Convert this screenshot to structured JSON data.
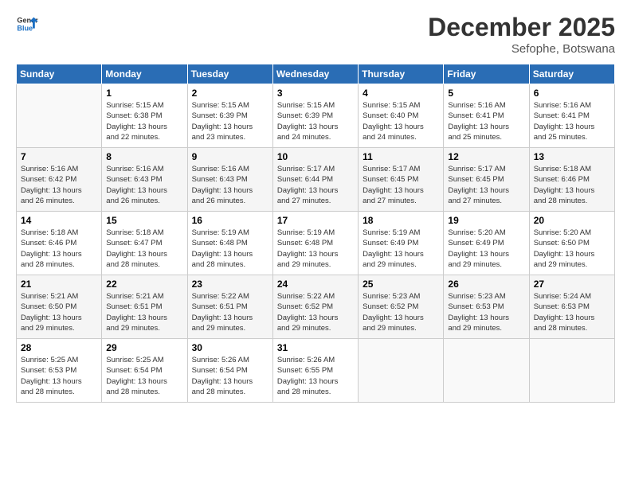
{
  "logo": {
    "line1": "General",
    "line2": "Blue"
  },
  "title": "December 2025",
  "subtitle": "Sefophe, Botswana",
  "days_header": [
    "Sunday",
    "Monday",
    "Tuesday",
    "Wednesday",
    "Thursday",
    "Friday",
    "Saturday"
  ],
  "weeks": [
    [
      {
        "day": "",
        "info": ""
      },
      {
        "day": "1",
        "info": "Sunrise: 5:15 AM\nSunset: 6:38 PM\nDaylight: 13 hours\nand 22 minutes."
      },
      {
        "day": "2",
        "info": "Sunrise: 5:15 AM\nSunset: 6:39 PM\nDaylight: 13 hours\nand 23 minutes."
      },
      {
        "day": "3",
        "info": "Sunrise: 5:15 AM\nSunset: 6:39 PM\nDaylight: 13 hours\nand 24 minutes."
      },
      {
        "day": "4",
        "info": "Sunrise: 5:15 AM\nSunset: 6:40 PM\nDaylight: 13 hours\nand 24 minutes."
      },
      {
        "day": "5",
        "info": "Sunrise: 5:16 AM\nSunset: 6:41 PM\nDaylight: 13 hours\nand 25 minutes."
      },
      {
        "day": "6",
        "info": "Sunrise: 5:16 AM\nSunset: 6:41 PM\nDaylight: 13 hours\nand 25 minutes."
      }
    ],
    [
      {
        "day": "7",
        "info": "Sunrise: 5:16 AM\nSunset: 6:42 PM\nDaylight: 13 hours\nand 26 minutes."
      },
      {
        "day": "8",
        "info": "Sunrise: 5:16 AM\nSunset: 6:43 PM\nDaylight: 13 hours\nand 26 minutes."
      },
      {
        "day": "9",
        "info": "Sunrise: 5:16 AM\nSunset: 6:43 PM\nDaylight: 13 hours\nand 26 minutes."
      },
      {
        "day": "10",
        "info": "Sunrise: 5:17 AM\nSunset: 6:44 PM\nDaylight: 13 hours\nand 27 minutes."
      },
      {
        "day": "11",
        "info": "Sunrise: 5:17 AM\nSunset: 6:45 PM\nDaylight: 13 hours\nand 27 minutes."
      },
      {
        "day": "12",
        "info": "Sunrise: 5:17 AM\nSunset: 6:45 PM\nDaylight: 13 hours\nand 27 minutes."
      },
      {
        "day": "13",
        "info": "Sunrise: 5:18 AM\nSunset: 6:46 PM\nDaylight: 13 hours\nand 28 minutes."
      }
    ],
    [
      {
        "day": "14",
        "info": "Sunrise: 5:18 AM\nSunset: 6:46 PM\nDaylight: 13 hours\nand 28 minutes."
      },
      {
        "day": "15",
        "info": "Sunrise: 5:18 AM\nSunset: 6:47 PM\nDaylight: 13 hours\nand 28 minutes."
      },
      {
        "day": "16",
        "info": "Sunrise: 5:19 AM\nSunset: 6:48 PM\nDaylight: 13 hours\nand 28 minutes."
      },
      {
        "day": "17",
        "info": "Sunrise: 5:19 AM\nSunset: 6:48 PM\nDaylight: 13 hours\nand 29 minutes."
      },
      {
        "day": "18",
        "info": "Sunrise: 5:19 AM\nSunset: 6:49 PM\nDaylight: 13 hours\nand 29 minutes."
      },
      {
        "day": "19",
        "info": "Sunrise: 5:20 AM\nSunset: 6:49 PM\nDaylight: 13 hours\nand 29 minutes."
      },
      {
        "day": "20",
        "info": "Sunrise: 5:20 AM\nSunset: 6:50 PM\nDaylight: 13 hours\nand 29 minutes."
      }
    ],
    [
      {
        "day": "21",
        "info": "Sunrise: 5:21 AM\nSunset: 6:50 PM\nDaylight: 13 hours\nand 29 minutes."
      },
      {
        "day": "22",
        "info": "Sunrise: 5:21 AM\nSunset: 6:51 PM\nDaylight: 13 hours\nand 29 minutes."
      },
      {
        "day": "23",
        "info": "Sunrise: 5:22 AM\nSunset: 6:51 PM\nDaylight: 13 hours\nand 29 minutes."
      },
      {
        "day": "24",
        "info": "Sunrise: 5:22 AM\nSunset: 6:52 PM\nDaylight: 13 hours\nand 29 minutes."
      },
      {
        "day": "25",
        "info": "Sunrise: 5:23 AM\nSunset: 6:52 PM\nDaylight: 13 hours\nand 29 minutes."
      },
      {
        "day": "26",
        "info": "Sunrise: 5:23 AM\nSunset: 6:53 PM\nDaylight: 13 hours\nand 29 minutes."
      },
      {
        "day": "27",
        "info": "Sunrise: 5:24 AM\nSunset: 6:53 PM\nDaylight: 13 hours\nand 28 minutes."
      }
    ],
    [
      {
        "day": "28",
        "info": "Sunrise: 5:25 AM\nSunset: 6:53 PM\nDaylight: 13 hours\nand 28 minutes."
      },
      {
        "day": "29",
        "info": "Sunrise: 5:25 AM\nSunset: 6:54 PM\nDaylight: 13 hours\nand 28 minutes."
      },
      {
        "day": "30",
        "info": "Sunrise: 5:26 AM\nSunset: 6:54 PM\nDaylight: 13 hours\nand 28 minutes."
      },
      {
        "day": "31",
        "info": "Sunrise: 5:26 AM\nSunset: 6:55 PM\nDaylight: 13 hours\nand 28 minutes."
      },
      {
        "day": "",
        "info": ""
      },
      {
        "day": "",
        "info": ""
      },
      {
        "day": "",
        "info": ""
      }
    ]
  ]
}
